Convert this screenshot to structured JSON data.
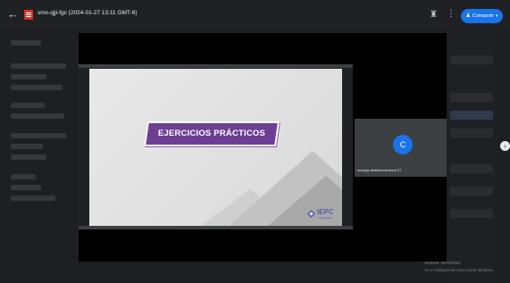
{
  "titlebar": {
    "doc_title": "smx-qjji-fgc (2024-01-27 13:11 GMT-6)",
    "share_label": "Compartir"
  },
  "icons": {
    "back": "arrow-left",
    "file": "video-file",
    "add_person": "add-person",
    "more": "more-vertical",
    "next": "chevron-right"
  },
  "slide": {
    "banner_text": "EJERCICIOS PRÁCTICOS",
    "logo_text": "IEPC",
    "logo_sub": "GUERRERO"
  },
  "participant": {
    "initial": "C",
    "name": "consejo distrital electoral 27"
  },
  "watermark": {
    "title": "Activar Windows",
    "subtitle": "Ve a Configuración para activar Windows."
  },
  "colors": {
    "accent": "#1a73e8",
    "banner": "#6c3f93",
    "file_icon": "#d93025"
  }
}
